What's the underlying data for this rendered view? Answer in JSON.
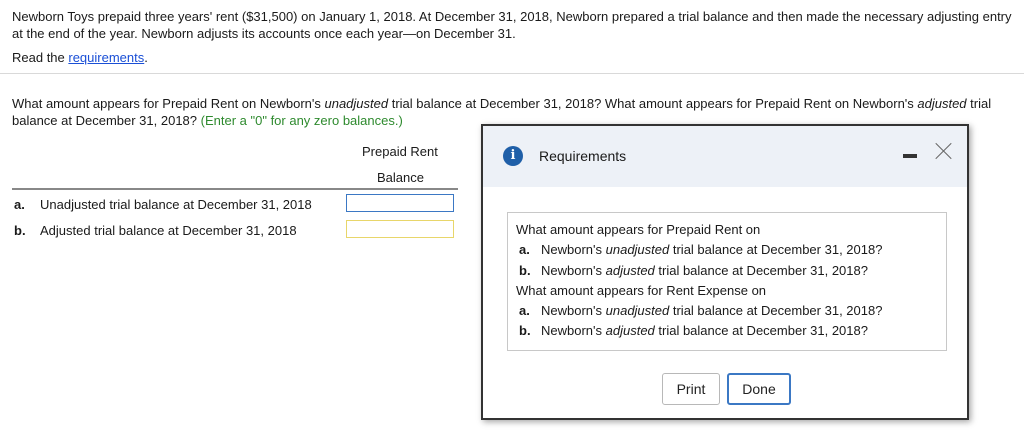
{
  "intro": {
    "text": "Newborn Toys prepaid three years' rent ($31,500) on January 1, 2018. At December 31, 2018, Newborn prepared a trial balance and then made the necessary adjusting entry at the end of the year. Newborn adjusts its accounts once each year—on December 31.",
    "read_prefix": "Read the ",
    "read_link": "requirements",
    "read_suffix": "."
  },
  "question": {
    "p1": "What amount appears for Prepaid Rent on Newborn's ",
    "em1": "unadjusted",
    "p2": " trial balance at December 31, 2018? What amount appears for Prepaid Rent on Newborn's ",
    "em2": "adjusted",
    "p3": " trial balance at December 31, 2018? ",
    "hint": "(Enter a \"0\" for any zero balances.)"
  },
  "table": {
    "header1": "Prepaid Rent",
    "header2": "Balance",
    "rows": [
      {
        "letter": "a.",
        "label": "Unadjusted trial balance at December 31, 2018",
        "value": ""
      },
      {
        "letter": "b.",
        "label": "Adjusted trial balance at December 31, 2018",
        "value": ""
      }
    ]
  },
  "dialog": {
    "info_icon": "i",
    "title": "Requirements",
    "intro1": "What amount appears for Prepaid Rent on",
    "intro2": "What amount appears for Rent Expense on",
    "items": [
      {
        "letter": "a.",
        "pre": "Newborn's ",
        "em": "unadjusted",
        "post": " trial balance at December 31, 2018?"
      },
      {
        "letter": "b.",
        "pre": "Newborn's ",
        "em": "adjusted",
        "post": " trial balance at December 31, 2018?"
      },
      {
        "letter": "a.",
        "pre": "Newborn's ",
        "em": "unadjusted",
        "post": " trial balance at December 31, 2018?"
      },
      {
        "letter": "b.",
        "pre": "Newborn's ",
        "em": "adjusted",
        "post": " trial balance at December 31, 2018?"
      }
    ],
    "print_label": "Print",
    "done_label": "Done"
  }
}
